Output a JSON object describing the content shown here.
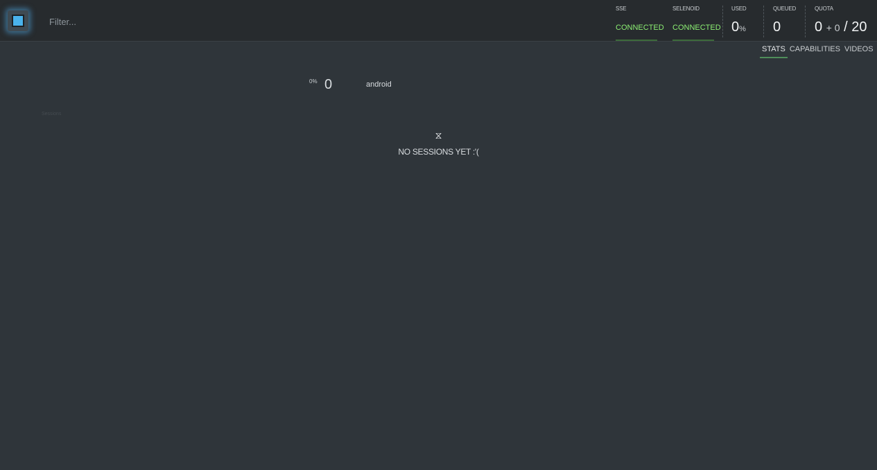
{
  "filter": {
    "placeholder": "Filter..."
  },
  "header": {
    "sse": {
      "label": "SSE",
      "status": "CONNECTED"
    },
    "selenoid": {
      "label": "SELENOID",
      "status": "CONNECTED"
    },
    "used": {
      "label": "USED",
      "value": "0",
      "unit": "%"
    },
    "queued": {
      "label": "QUEUED",
      "value": "0"
    },
    "quota": {
      "label": "QUOTA",
      "used": "0",
      "plus": "+ 0",
      "total": "/ 20"
    }
  },
  "tabs": [
    {
      "label": "STATS",
      "active": true
    },
    {
      "label": "CAPABILITIES",
      "active": false
    },
    {
      "label": "VIDEOS",
      "active": false
    }
  ],
  "browsers": [
    {
      "percent": "0%",
      "count": "0",
      "name": "android"
    }
  ],
  "sessions_label": "Sessions",
  "empty_state": {
    "icon": "hourglass-icon",
    "glyph": "⧖",
    "message": "NO SESSIONS YET :'("
  },
  "colors": {
    "connected": "#8cef73",
    "accent": "#4ab3ec",
    "background": "#2f353a"
  }
}
